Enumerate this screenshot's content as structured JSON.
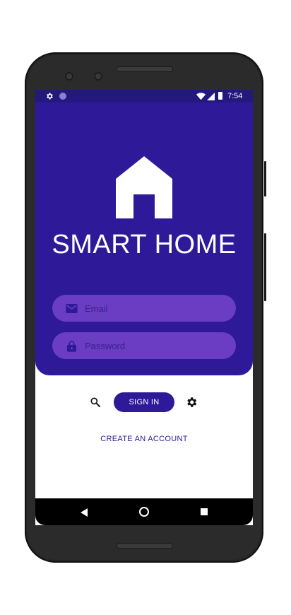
{
  "status_bar": {
    "time": "7:54"
  },
  "app": {
    "title": "SMART HOME"
  },
  "login": {
    "email_placeholder": "Email",
    "password_placeholder": "Password"
  },
  "actions": {
    "sign_in_label": "SIGN IN",
    "create_account_label": "CREATE AN ACCOUNT"
  },
  "icons": {
    "status_left": [
      "gear-icon",
      "circle-icon"
    ],
    "status_right": [
      "wifi-icon",
      "signal-icon",
      "battery-icon"
    ],
    "email": "mail-icon",
    "password": "lock-icon",
    "search": "search-icon",
    "settings": "gear-icon",
    "nav": [
      "back-icon",
      "home-icon",
      "recents-icon"
    ]
  },
  "colors": {
    "primary": "#2e1a99",
    "status_bar": "#23187e",
    "field_bg": "#6a3dc2"
  }
}
